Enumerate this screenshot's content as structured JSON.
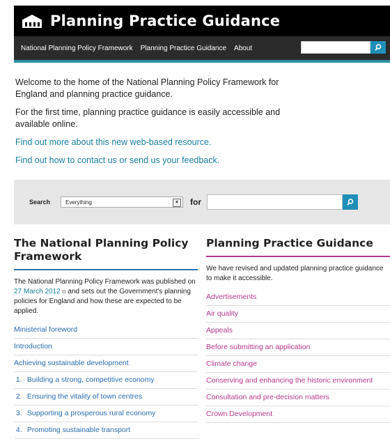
{
  "header": {
    "title": "Planning Practice Guidance",
    "logo_icon": "crown-building-icon"
  },
  "nav": {
    "items": [
      "National Planning Policy Framework",
      "Planning Practice Guidance",
      "About"
    ],
    "search_placeholder": "",
    "search_icon": "search-icon"
  },
  "intro": {
    "para1": "Welcome to the home of the National Planning Policy Framework for England and planning practice guidance.",
    "para2": "For the first time, planning practice guidance is easily accessible and available online.",
    "link1": "Find out more about this new web-based resource.",
    "link2": "Find out how to contact us or send us your feedback."
  },
  "search": {
    "label": "Search",
    "scope_selected": "Everything",
    "for_label": "for",
    "query_value": ""
  },
  "nppf": {
    "heading": "The National Planning Policy Framework",
    "desc_before": "The National Planning Policy Framework was published on ",
    "desc_link": "27 March 2012",
    "desc_after": " and sets out the Government's planning policies for England and how these are expected to be applied.",
    "items": [
      {
        "num": "",
        "label": "Ministerial foreword"
      },
      {
        "num": "",
        "label": "Introduction"
      },
      {
        "num": "",
        "label": "Achieving sustainable development"
      },
      {
        "num": "1.",
        "label": "Building a strong, competitive economy"
      },
      {
        "num": "2.",
        "label": "Ensuring the vitality of town centres"
      },
      {
        "num": "3.",
        "label": "Supporting a prosperous rural economy"
      },
      {
        "num": "4.",
        "label": "Promoting sustainable transport"
      }
    ]
  },
  "ppg": {
    "heading": "Planning Practice Guidance",
    "desc": "We have revised and updated planning practice guidance to make it accessible.",
    "items": [
      "Advertisements",
      "Air quality",
      "Appeals",
      "Before submitting an application",
      "Climate change",
      "Conserving and enhancing the historic environment",
      "Consultation and pre-decision matters",
      "Crown Development"
    ]
  },
  "colors": {
    "header_bg": "#000000",
    "nav_bg": "#2b2b2b",
    "accent_teal": "#2d8fa6",
    "link_blue": "#2a6cb0",
    "link_magenta": "#b5398a"
  }
}
